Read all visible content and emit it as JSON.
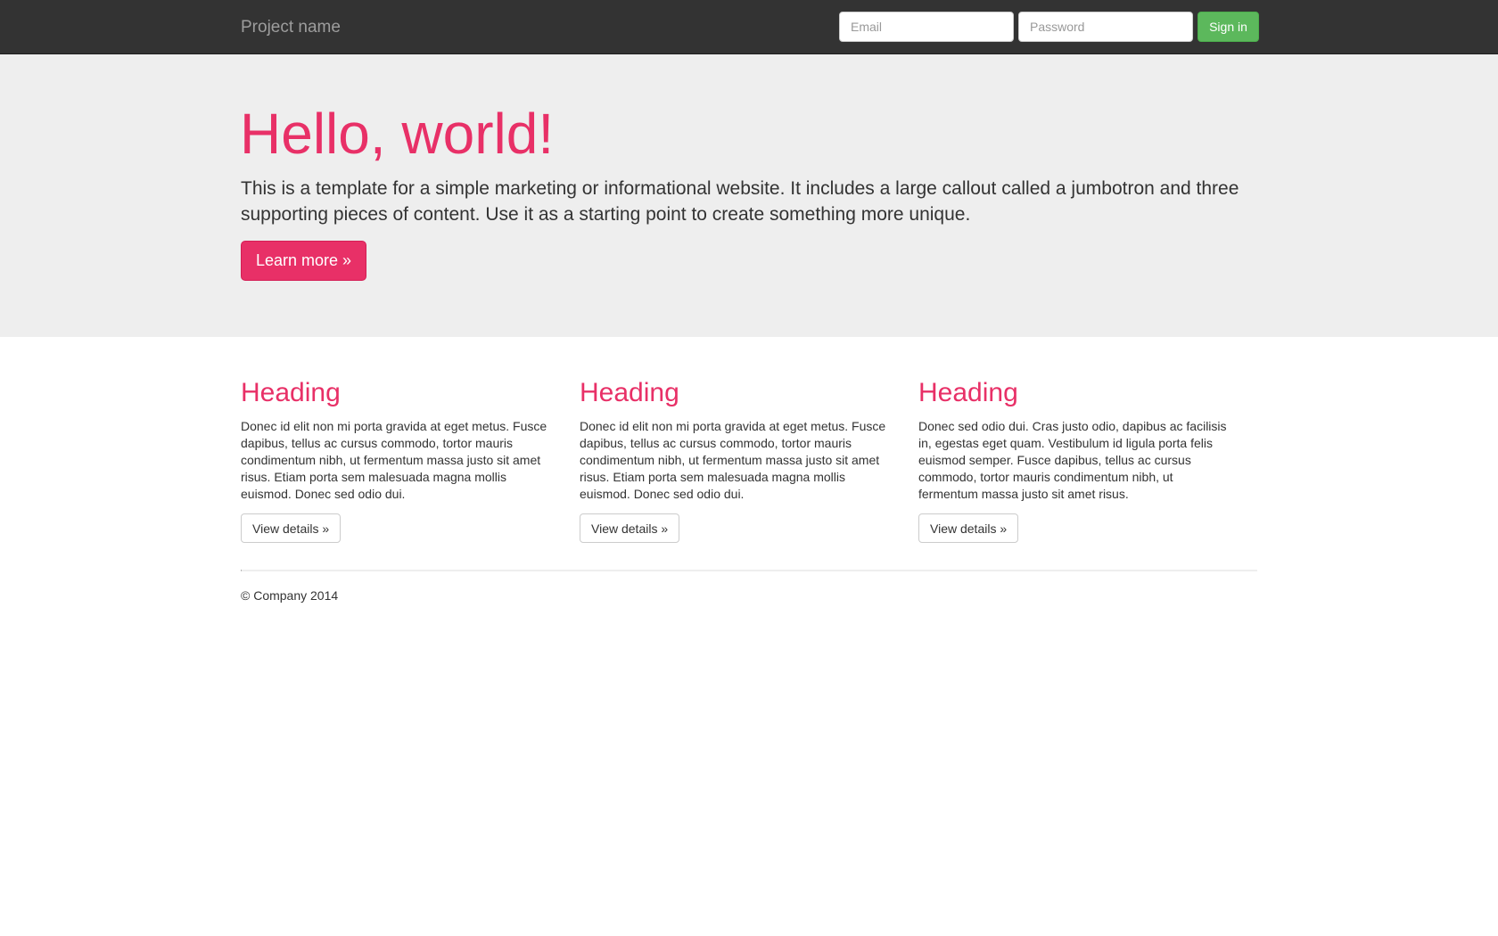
{
  "navbar": {
    "brand": "Project name",
    "email_placeholder": "Email",
    "password_placeholder": "Password",
    "signin_label": "Sign in"
  },
  "jumbotron": {
    "title": "Hello, world!",
    "lead": "This is a template for a simple marketing or informational website. It includes a large callout called a jumbotron and three supporting pieces of content. Use it as a starting point to create something more unique.",
    "button_label": "Learn more »"
  },
  "columns": [
    {
      "heading": "Heading",
      "text": "Donec id elit non mi porta gravida at eget metus. Fusce dapibus, tellus ac cursus commodo, tortor mauris condimentum nibh, ut fermentum massa justo sit amet risus. Etiam porta sem malesuada magna mollis euismod. Donec sed odio dui.",
      "button_label": "View details »"
    },
    {
      "heading": "Heading",
      "text": "Donec id elit non mi porta gravida at eget metus. Fusce dapibus, tellus ac cursus commodo, tortor mauris condimentum nibh, ut fermentum massa justo sit amet risus. Etiam porta sem malesuada magna mollis euismod. Donec sed odio dui.",
      "button_label": "View details »"
    },
    {
      "heading": "Heading",
      "text": "Donec sed odio dui. Cras justo odio, dapibus ac facilisis in, egestas eget quam. Vestibulum id ligula porta felis euismod semper. Fusce dapibus, tellus ac cursus commodo, tortor mauris condimentum nibh, ut fermentum massa justo sit amet risus.",
      "button_label": "View details »"
    }
  ],
  "footer": {
    "text": "© Company 2014"
  },
  "colors": {
    "navbar_bg": "#333333",
    "accent": "#e83067",
    "signin_green": "#5cb85c",
    "jumbotron_bg": "#eeeeee"
  }
}
